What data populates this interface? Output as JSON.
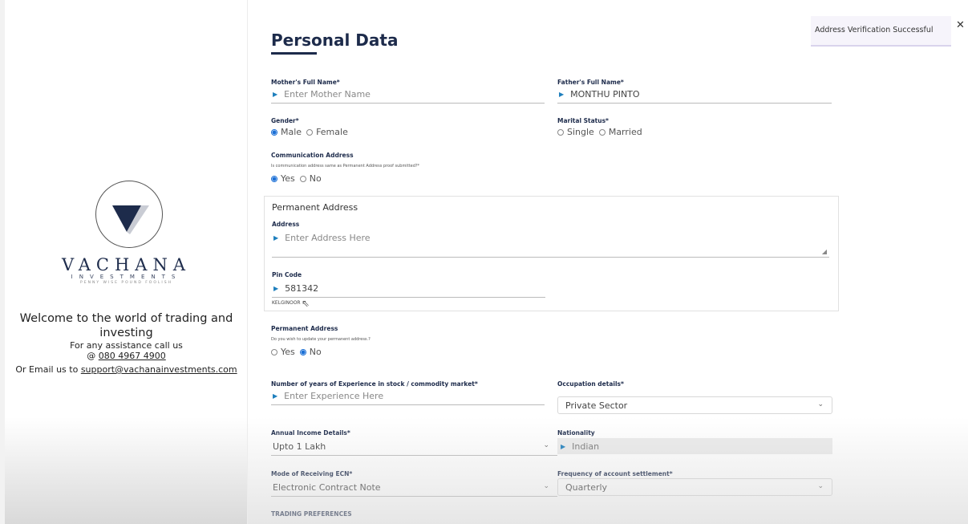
{
  "sidebar": {
    "brand_name": "VACHANA",
    "brand_sub": "INVESTMENTS",
    "brand_tagline": "PENNY WISE POUND FOOLISH",
    "welcome_line1": "Welcome to the world of trading and",
    "welcome_line2": "investing",
    "assist_text": "For any assistance call us",
    "assist_prefix": "@",
    "phone": "080 4967 4900",
    "email_prefix": "Or Email us to",
    "email": "support@vachanainvestments.com"
  },
  "page": {
    "title": "Personal Data"
  },
  "form": {
    "mother": {
      "label": "Mother's Full Name*",
      "placeholder": "Enter Mother Name"
    },
    "father": {
      "label": "Father's Full Name*",
      "value": "MONTHU PINTO"
    },
    "gender": {
      "label": "Gender*",
      "options": [
        "Male",
        "Female"
      ],
      "selected": "Male"
    },
    "marital": {
      "label": "Marital Status*",
      "options": [
        "Single",
        "Married"
      ]
    },
    "comm_address": {
      "label": "Communication Address",
      "question": "Is communication address same as Permanent Address proof submitted?*",
      "options": [
        "Yes",
        "No"
      ],
      "selected": "Yes"
    },
    "permanent_box": {
      "title": "Permanent Address",
      "address_label": "Address",
      "address_placeholder": "Enter Address Here",
      "pin_label": "Pin Code",
      "pin_value": "581342",
      "town_hint": "KELGINOOR"
    },
    "perm_update": {
      "label": "Permanent Address",
      "question": "Do you wish to update your permanent address.?",
      "options": [
        "Yes",
        "No"
      ],
      "selected": "No"
    },
    "experience": {
      "label": "Number of years of Experience in stock / commodity market*",
      "placeholder": "Enter Experience Here"
    },
    "occupation": {
      "label": "Occupation details*",
      "value": "Private Sector"
    },
    "income": {
      "label": "Annual Income Details*",
      "value": "Upto 1 Lakh"
    },
    "nationality": {
      "label": "Nationality",
      "value": "Indian"
    },
    "ecn": {
      "label": "Mode of Receiving ECN*",
      "value": "Electronic Contract Note"
    },
    "settlement": {
      "label": "Frequency of account settlement*",
      "value": "Quarterly"
    },
    "trading_pref": "TRADING PREFERENCES"
  },
  "toast": {
    "message": "Address Verification Successful",
    "close": "✕"
  },
  "icons": {
    "arrow": "caret-right-icon",
    "chevron": "chevron-down-icon"
  },
  "colors": {
    "brand_navy": "#1d2b4b",
    "radio_blue": "#1a6fd6",
    "arrow_blue": "#1e7fbd"
  }
}
